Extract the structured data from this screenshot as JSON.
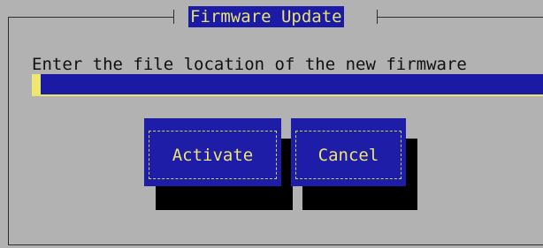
{
  "dialog": {
    "title": "Firmware Update",
    "prompt": "Enter the file location of the new firmware",
    "input_value": "",
    "activate_label": "Activate",
    "cancel_label": "Cancel"
  },
  "colors": {
    "background": "#b2b2b2",
    "accent_blue": "#1d1da8",
    "text_yellow": "#eee471",
    "shadow": "#000000"
  }
}
